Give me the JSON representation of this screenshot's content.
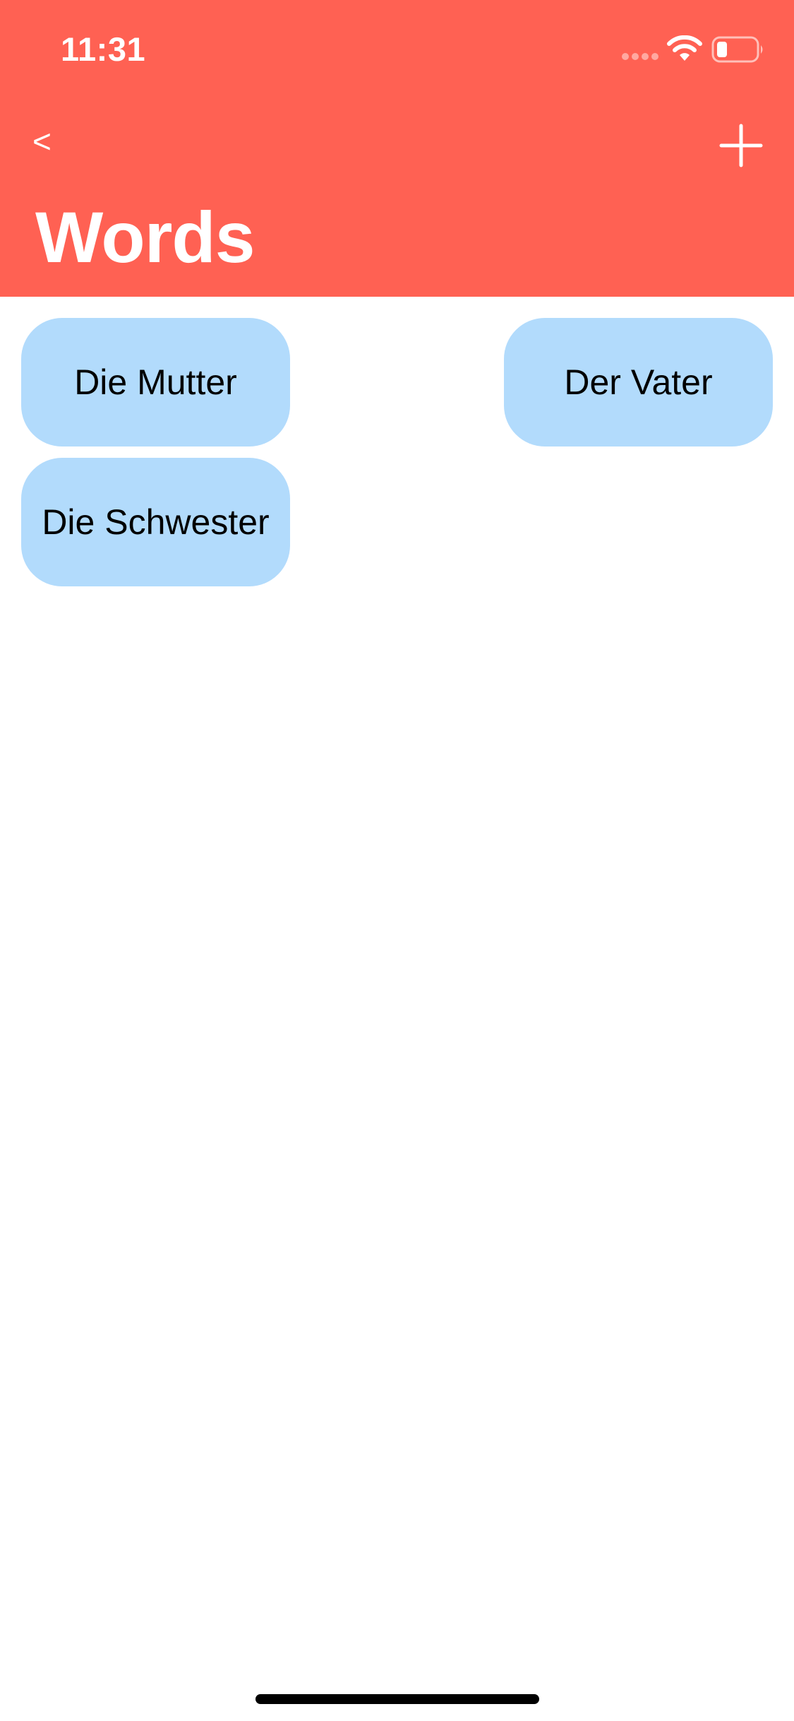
{
  "status_bar": {
    "time": "11:31",
    "icons": [
      "signal-dots-icon",
      "wifi-icon",
      "battery-icon"
    ]
  },
  "nav": {
    "back_label": "<",
    "add_icon": "plus-icon",
    "title": "Words"
  },
  "words": [
    {
      "label": "Die Mutter"
    },
    {
      "label": "Der Vater"
    },
    {
      "label": "Die Schwester"
    }
  ],
  "colors": {
    "header": "#FF6153",
    "card": "#B2DBFC",
    "text_on_header": "#FFFFFF",
    "card_text": "#000000"
  }
}
